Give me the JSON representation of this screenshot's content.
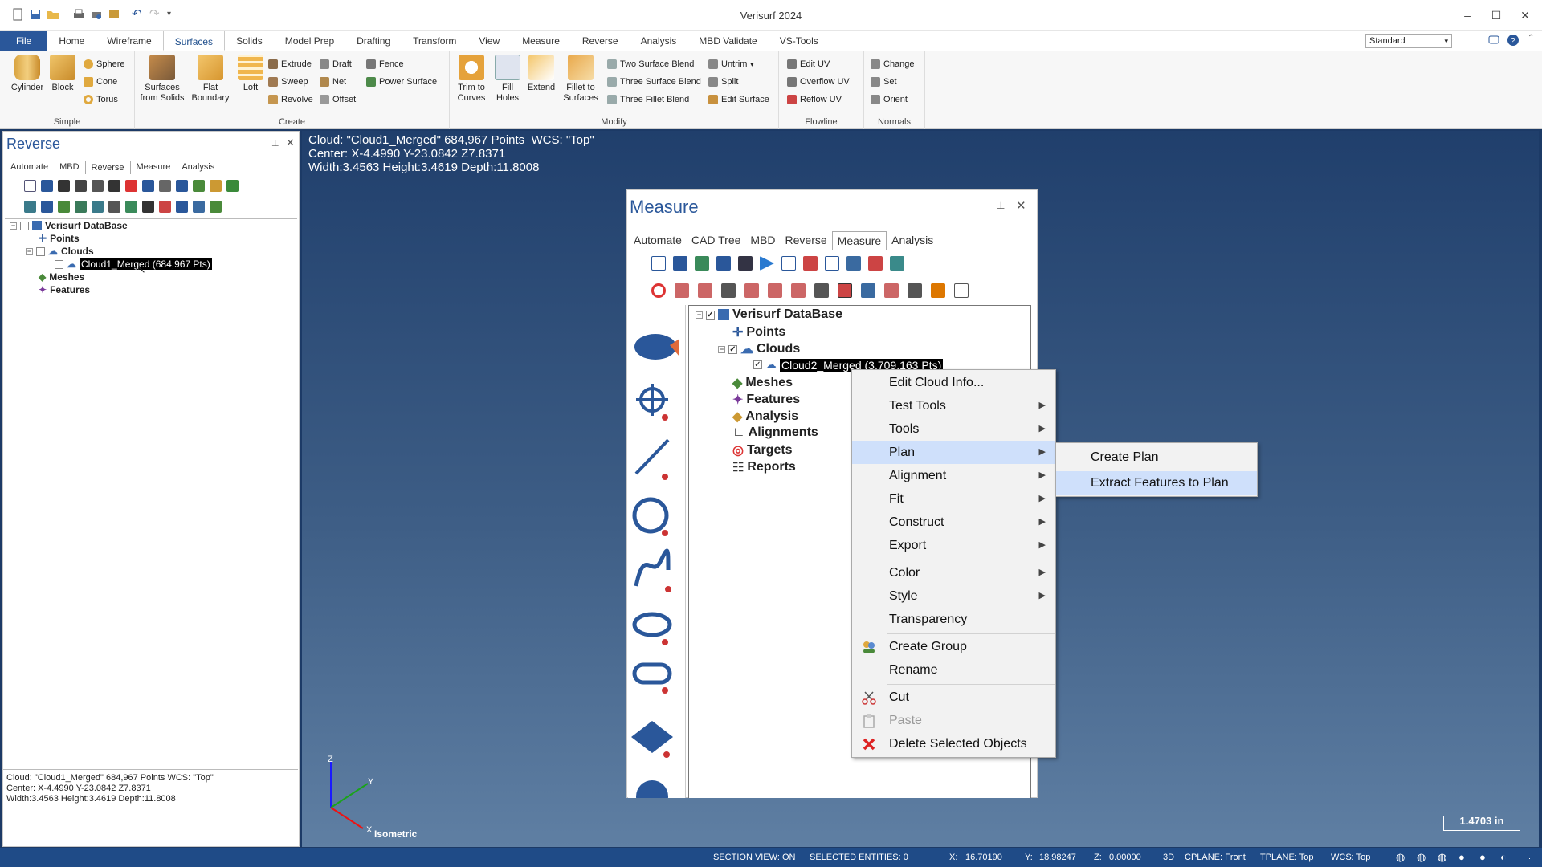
{
  "window": {
    "title": "Verisurf 2024"
  },
  "ribbon_tabs": [
    "File",
    "Home",
    "Wireframe",
    "Surfaces",
    "Solids",
    "Model Prep",
    "Drafting",
    "Transform",
    "View",
    "Measure",
    "Reverse",
    "Analysis",
    "MBD Validate",
    "VS-Tools"
  ],
  "standard_select": "Standard",
  "ribbon": {
    "simple": {
      "label": "Simple",
      "cylinder": "Cylinder",
      "block": "Block",
      "sphere": "Sphere",
      "cone": "Cone",
      "torus": "Torus"
    },
    "create": {
      "label": "Create",
      "surfaces_from_solids": "Surfaces\nfrom Solids",
      "flat_boundary": "Flat\nBoundary",
      "loft": "Loft",
      "extrude": "Extrude",
      "sweep": "Sweep",
      "revolve": "Revolve",
      "draft": "Draft",
      "net": "Net",
      "offset": "Offset",
      "fence": "Fence",
      "power_surface": "Power Surface"
    },
    "modify": {
      "label": "Modify",
      "trim_to_curves": "Trim to\nCurves",
      "fill_holes": "Fill\nHoles",
      "extend": "Extend",
      "fillet_to_surfaces": "Fillet to\nSurfaces",
      "two_surface_blend": "Two Surface Blend",
      "three_surface_blend": "Three Surface Blend",
      "three_fillet_blend": "Three Fillet Blend",
      "untrim": "Untrim",
      "split": "Split",
      "edit_surface": "Edit Surface"
    },
    "flowline": {
      "label": "Flowline",
      "edit_uv": "Edit UV",
      "overflow_uv": "Overflow UV",
      "reflow_uv": "Reflow UV"
    },
    "normals": {
      "label": "Normals",
      "change": "Change",
      "set": "Set",
      "orient": "Orient"
    }
  },
  "left_panel": {
    "title": "Reverse",
    "tabs": [
      "Automate",
      "MBD",
      "Reverse",
      "Measure",
      "Analysis"
    ],
    "tree": {
      "root": "Verisurf DataBase",
      "points": "Points",
      "clouds": "Clouds",
      "cloud_item": "Cloud1_Merged (684,967 Pts)",
      "meshes": "Meshes",
      "features": "Features"
    },
    "info": [
      "Cloud: \"Cloud1_Merged\" 684,967 Points  WCS: \"Top\"",
      "Center: X-4.4990 Y-23.0842 Z7.8371",
      "Width:3.4563 Height:3.4619 Depth:11.8008"
    ]
  },
  "viewport": {
    "info": [
      "Cloud: \"Cloud1_Merged\" 684,967 Points  WCS: \"Top\"",
      "Center: X-4.4990 Y-23.0842 Z7.8371",
      "Width:3.4563 Height:3.4619 Depth:11.8008"
    ],
    "view_label": "Isometric",
    "scale": "1.4703 in",
    "axes": {
      "z": "Z",
      "y": "Y",
      "x": "X"
    }
  },
  "measure_panel": {
    "title": "Measure",
    "tabs": [
      "Automate",
      "CAD Tree",
      "MBD",
      "Reverse",
      "Measure",
      "Analysis"
    ],
    "tree": {
      "root": "Verisurf DataBase",
      "points": "Points",
      "clouds": "Clouds",
      "cloud_item": "Cloud2_Merged (3,709,163 Pts)",
      "meshes": "Meshes",
      "features": "Features",
      "analysis": "Analysis",
      "alignments": "Alignments",
      "targets": "Targets",
      "reports": "Reports"
    }
  },
  "context_menu": {
    "items": [
      "Edit Cloud Info...",
      "Test Tools",
      "Tools",
      "Plan",
      "Alignment",
      "Fit",
      "Construct",
      "Export",
      "Color",
      "Style",
      "Transparency",
      "Create Group",
      "Rename",
      "Cut",
      "Paste",
      "Delete Selected Objects"
    ]
  },
  "submenu": {
    "items": [
      "Create Plan",
      "Extract Features to Plan"
    ]
  },
  "status": {
    "section_view": "SECTION VIEW: ON",
    "selected_entities": "SELECTED ENTITIES: 0",
    "x": "X:",
    "x_val": "16.70190",
    "y": "Y:",
    "y_val": "18.98247",
    "z": "Z:",
    "z_val": "0.00000",
    "mode": "3D",
    "cplane": "CPLANE: Front",
    "tplane": "TPLANE: Top",
    "wcs": "WCS: Top"
  },
  "colors": {
    "accent": "#2a579a",
    "status_bg": "#1f4b87",
    "menu_highlight": "#cfe0fb"
  }
}
